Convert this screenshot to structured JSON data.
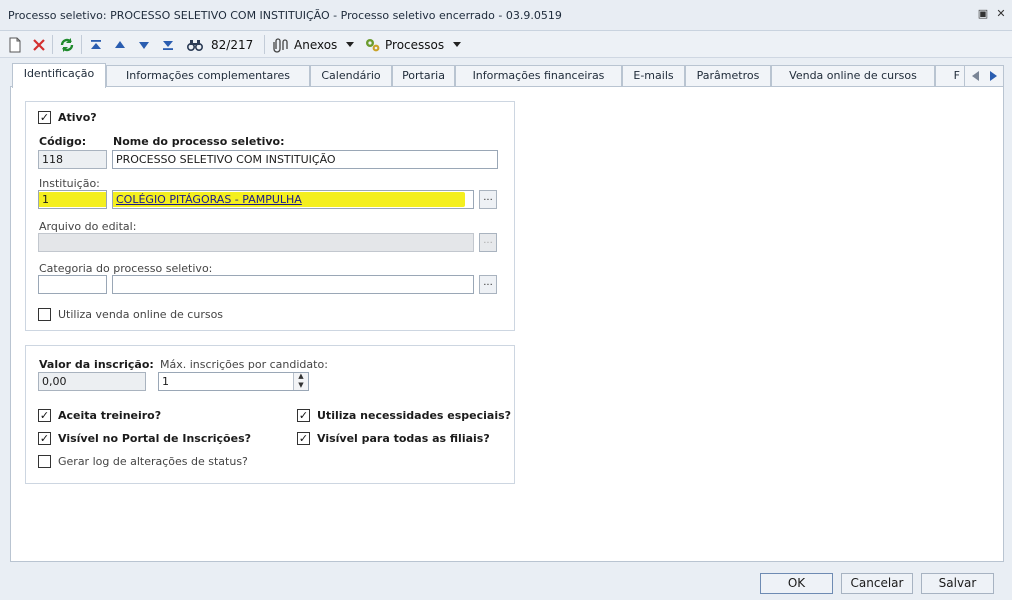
{
  "window": {
    "title": "Processo seletivo: PROCESSO SELETIVO COM INSTITUIÇÃO - Processo seletivo encerrado - 03.9.0519",
    "restore_glyph": "▣",
    "close_glyph": "✕"
  },
  "toolbar": {
    "record_counter": "82/217",
    "anexos_label": "Anexos",
    "processos_label": "Processos"
  },
  "tabs": [
    {
      "label": "Identificação"
    },
    {
      "label": "Informações complementares"
    },
    {
      "label": "Calendário"
    },
    {
      "label": "Portaria"
    },
    {
      "label": "Informações financeiras"
    },
    {
      "label": "E-mails"
    },
    {
      "label": "Parâmetros"
    },
    {
      "label": "Venda online de cursos"
    },
    {
      "label": "F"
    }
  ],
  "form": {
    "ativo_label": "Ativo?",
    "ativo_checked": "✓",
    "codigo_label": "Código:",
    "codigo_value": "118",
    "nome_label": "Nome do processo seletivo:",
    "nome_value": "PROCESSO SELETIVO COM INSTITUIÇÃO",
    "instituicao_label": "Instituição:",
    "instituicao_code": "1",
    "instituicao_name": "COLÉGIO PITÁGORAS - PAMPULHA",
    "arquivo_label": "Arquivo do edital:",
    "categoria_label": "Categoria do processo seletivo:",
    "browse_label": "...",
    "venda_online_label": "Utiliza venda online de cursos",
    "valor_label": "Valor da inscrição:",
    "valor_value": "0,00",
    "max_label": "Máx. inscrições por candidato:",
    "max_value": "1",
    "aceita_treineiro_label": "Aceita treineiro?",
    "visivel_portal_label": "Visível no Portal de Inscrições?",
    "gerar_log_label": "Gerar log de alterações de status?",
    "necessidades_label": "Utiliza necessidades especiais?",
    "visivel_filiais_label": "Visível para todas as filiais?",
    "check_mark": "✓",
    "spin_up": "▲",
    "spin_down": "▼"
  },
  "footer": {
    "ok_label": "OK",
    "cancel_label": "Cancelar",
    "save_label": "Salvar"
  },
  "colors": {
    "highlight": "#f4ef1f",
    "cancel_red": "#d32f2f",
    "refresh_green": "#1f8a2c",
    "nav_blue": "#2a5db0"
  }
}
